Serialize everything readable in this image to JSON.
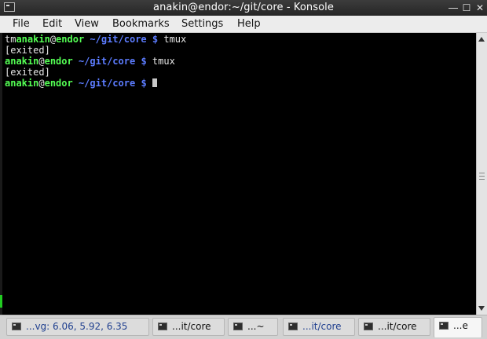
{
  "window": {
    "title": "anakin@endor:~/git/core - Konsole",
    "minimize_glyph": "―",
    "maximize_glyph": "☐",
    "close_glyph": "✕"
  },
  "menu": {
    "items": [
      "File",
      "Edit",
      "View",
      "Bookmarks",
      "Settings",
      "Help"
    ]
  },
  "terminal": {
    "prompt_user": "anakin",
    "prompt_at": "@",
    "prompt_host": "endor",
    "prompt_cwd": "~/git/core",
    "prompt_symbol": "$",
    "line1_prefix": "tm",
    "line1_cmd": "tmux",
    "line2_text": "[exited]",
    "line3_cmd": "tmux",
    "line4_text": "[exited]"
  },
  "tabs": [
    {
      "label": "...vg: 6.06, 5.92, 6.35",
      "active": false
    },
    {
      "label": "...it/core",
      "active": false
    },
    {
      "label": "...~",
      "active": false
    },
    {
      "label": "...it/core",
      "active": false
    },
    {
      "label": "...it/core",
      "active": false
    },
    {
      "label": "...e",
      "active": true
    }
  ],
  "colors": {
    "prompt_user_host": "#54ff54",
    "prompt_path": "#5c7cff",
    "terminal_bg": "#000000",
    "tab_text": "#1f3f8f"
  }
}
